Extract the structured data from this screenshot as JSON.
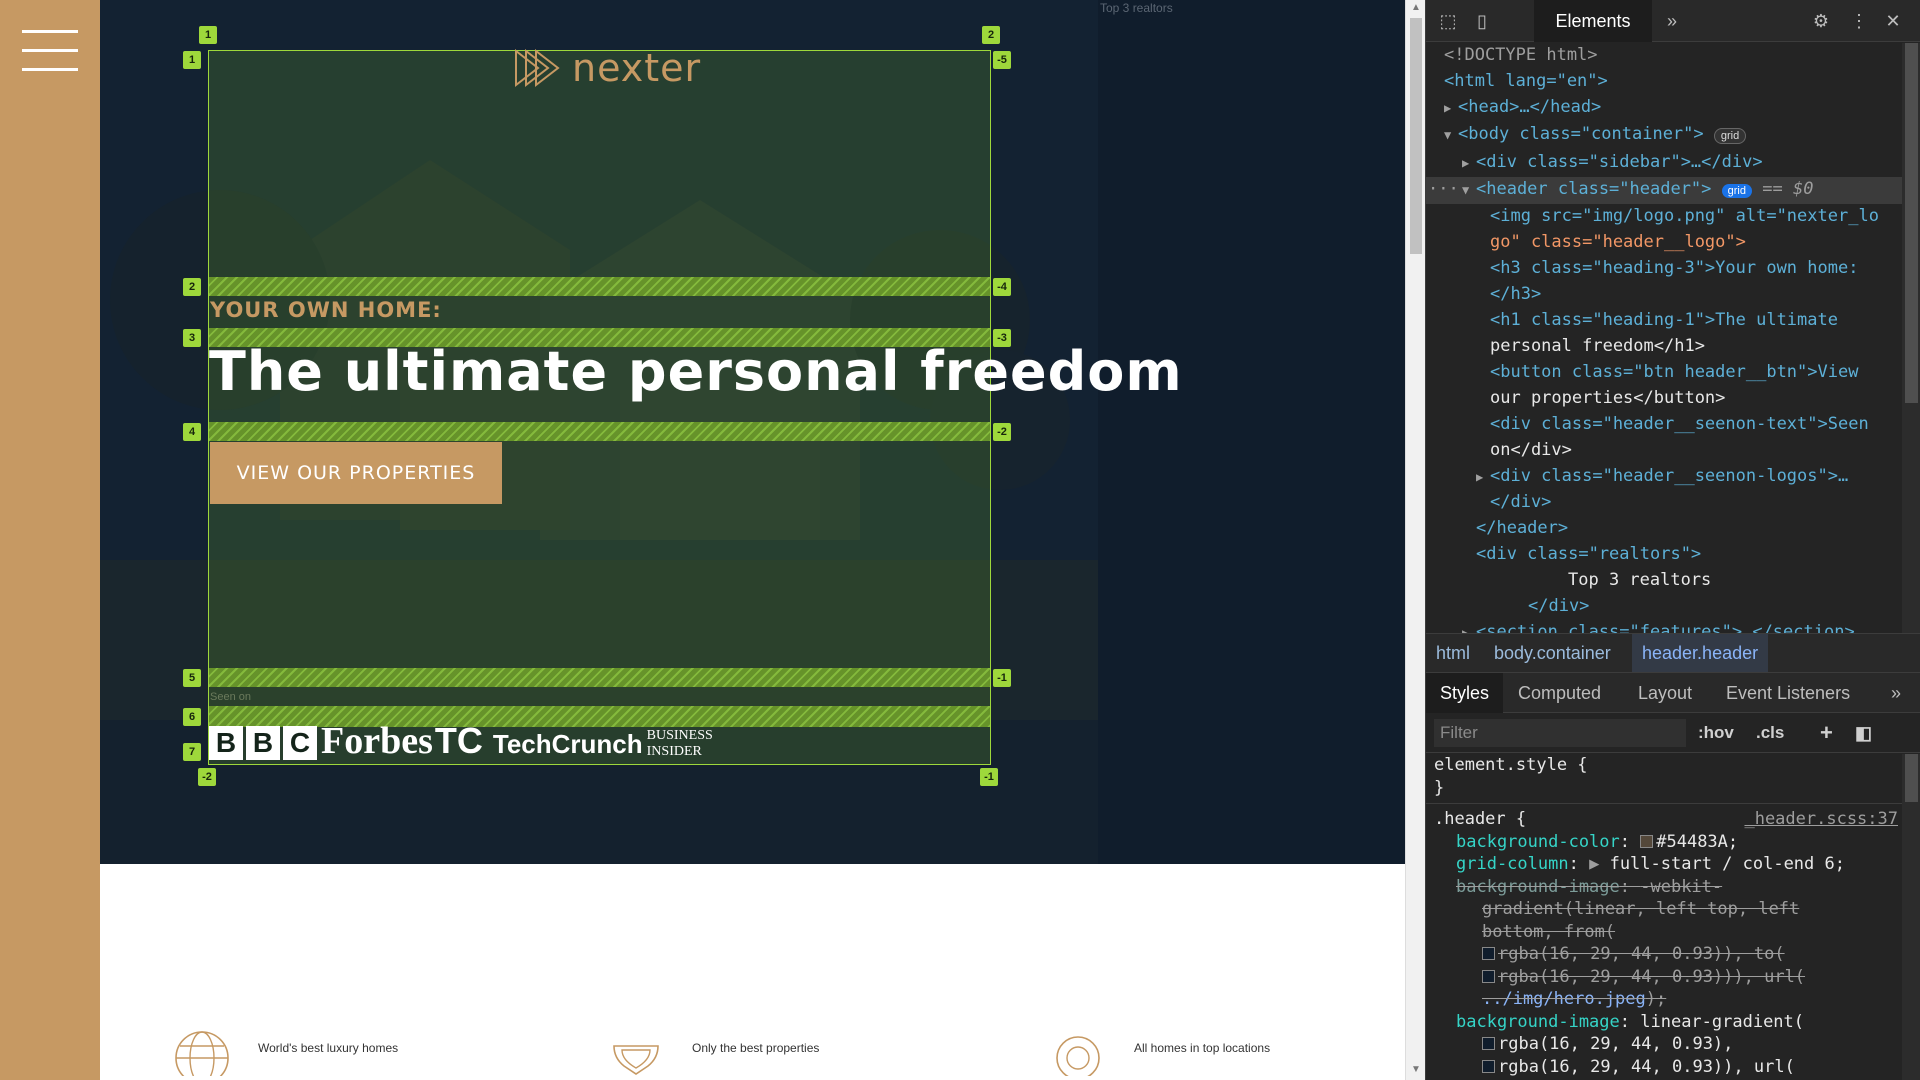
{
  "page": {
    "logo_text": "nexter",
    "heading3": "YOUR OWN HOME:",
    "heading1": "The ultimate personal freedom",
    "cta_label": "VIEW OUR PROPERTIES",
    "seen_on": "Seen on",
    "press_logos": {
      "bbc": [
        "B",
        "B",
        "C"
      ],
      "forbes": "Forbes",
      "tc_mark": "TC",
      "techcrunch": "TechCrunch",
      "bi_line1": "Business",
      "bi_line2": "Insider"
    },
    "realtors_text": "Top 3 realtors",
    "features": [
      {
        "icon": "globe-icon",
        "label": "World's best luxury homes"
      },
      {
        "icon": "trophy-icon",
        "label": "Only the best properties"
      },
      {
        "icon": "map-pin-icon",
        "label": "All homes in top locations"
      }
    ],
    "grid_badges": {
      "top": [
        "1",
        "2"
      ],
      "left": [
        "1",
        "2",
        "3",
        "4",
        "5",
        "6",
        "7"
      ],
      "right": [
        "-5",
        "-4",
        "-3",
        "-2",
        "-1"
      ],
      "bottom": [
        "-2",
        "-1"
      ]
    },
    "colors": {
      "sidebar": "#c69963",
      "header_bg": "#54483A",
      "overlay": "#101d2c",
      "grid_lines": "#9ed83b"
    }
  },
  "devtools": {
    "active_tab": "Elements",
    "dom": {
      "doctype": "<!DOCTYPE html>",
      "html_open": "<html lang=\"en\">",
      "head": "<head>…</head>",
      "body_open": "<body class=\"container\">",
      "body_badge": "grid",
      "sidebar": "<div class=\"sidebar\">…</div>",
      "header_open": "<header class=\"header\">",
      "header_badge": "grid",
      "header_ref": "== $0",
      "img_line1": "<img src=\"img/logo.png\" alt=\"nexter_lo",
      "img_line2": "go\" class=\"header__logo\">",
      "h3_line1": "<h3 class=\"heading-3\">Your own home:",
      "h3_line2": "</h3>",
      "h1_line1": "<h1 class=\"heading-1\">The ultimate",
      "h1_line2": "personal freedom</h1>",
      "btn_line1": "<button class=\"btn header__btn\">View",
      "btn_line2": "our properties</button>",
      "seenon_line1": "<div class=\"header__seenon-text\">Seen",
      "seenon_line2": "on</div>",
      "logos_line": "<div class=\"header__seenon-logos\">…",
      "div_close": "</div>",
      "header_close": "</header>",
      "realtors_open": "<div class=\"realtors\">",
      "realtors_text": "Top 3 realtors",
      "realtors_close": "</div>",
      "section_line": "<section class=\"features\">…</section>"
    },
    "breadcrumbs": [
      "html",
      "body.container",
      "header.header"
    ],
    "panel_tabs": [
      "Styles",
      "Computed",
      "Layout",
      "Event Listeners"
    ],
    "filter_placeholder": "Filter",
    "filter_buttons": [
      ":hov",
      ".cls"
    ],
    "styles": {
      "element_style_open": "element.style {",
      "element_style_close": "}",
      "header_selector": ".header {",
      "header_source": "_header.scss:37",
      "bg_color_prop": "background-color",
      "bg_color_val": "#54483A;",
      "grid_col_prop": "grid-column",
      "grid_col_val": "full-start / col-end 6;",
      "bgimg_prop_struck": "background-image",
      "bgimg_val_struck1": "-webkit-",
      "bgimg_val_struck2": "gradient(linear, left top, left",
      "bgimg_val_struck3": "bottom, from(",
      "bgimg_val_struck4": "rgba(16, 29, 44, 0.93)), to(",
      "bgimg_val_struck5": "rgba(16, 29, 44, 0.93))), url(",
      "bgimg_val_struck6": "../img/hero.jpeg",
      "bgimg_val_struck6_end": ");",
      "bgimg_prop": "background-image",
      "bgimg_val1": "linear-gradient(",
      "bgimg_val2": "rgba(16, 29, 44, 0.93),",
      "bgimg_val3": "rgba(16, 29, 44, 0.93)), url("
    }
  }
}
